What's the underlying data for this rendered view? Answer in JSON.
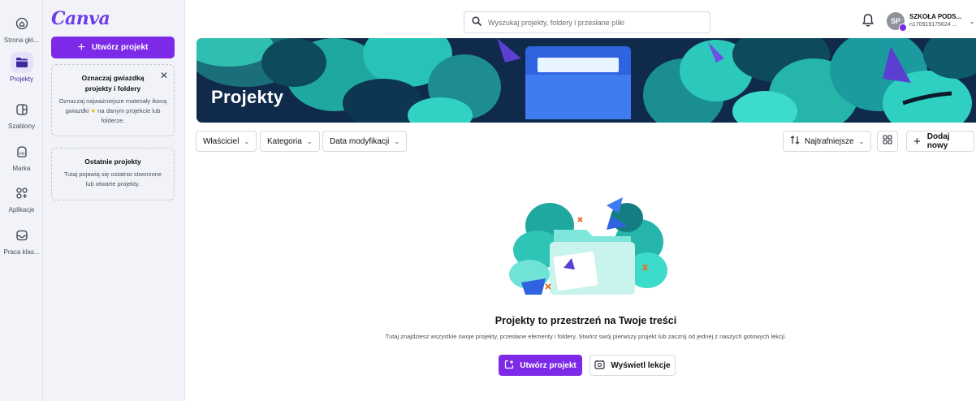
{
  "rail": {
    "items": [
      {
        "label": "Strona głó..."
      },
      {
        "label": "Projekty"
      },
      {
        "label": "Szablony"
      },
      {
        "label": "Marka"
      },
      {
        "label": "Aplikacje"
      },
      {
        "label": "Praca klas..."
      }
    ]
  },
  "panel": {
    "logo": "Canva",
    "create_button": "Utwórz projekt",
    "star_card": {
      "title": "Oznaczaj gwiazdką projekty i foldery",
      "text_before": "Oznaczaj najważniejsze materiały ikoną gwiazdki",
      "text_after": "na danym projekcie lub folderze."
    },
    "recent_card": {
      "title": "Ostatnie projekty",
      "text": "Tutaj pojawią się ostatnio stworzone lub otwarte projekty."
    }
  },
  "topbar": {
    "search_placeholder": "Wyszukaj projekty, foldery i przesłane pliki",
    "account_initials": "SP",
    "account_name": "SZKOŁA PODS...",
    "account_sub": "n170919175624 ..."
  },
  "banner": {
    "title": "Projekty"
  },
  "filters": {
    "owner": "Właściciel",
    "category": "Kategoria",
    "modified": "Data modyfikacji",
    "sort": "Najtrafniejsze",
    "add_new": "Dodaj nowy"
  },
  "empty_state": {
    "title": "Projekty to przestrzeń na Twoje treści",
    "text": "Tutaj znajdziesz wszystkie swoje projekty, przesłane elementy i foldery. Stwórz swój pierwszy projekt lub zacznij od jednej z naszych gotowych lekcji.",
    "create_button": "Utwórz projekt",
    "lessons_button": "Wyświetl lekcje"
  },
  "colors": {
    "brand_purple": "#7d2ae8",
    "rail_active": "#e7e0fb",
    "banner_dark": "#0f2a4a",
    "banner_teal": "#2ec4b6"
  }
}
